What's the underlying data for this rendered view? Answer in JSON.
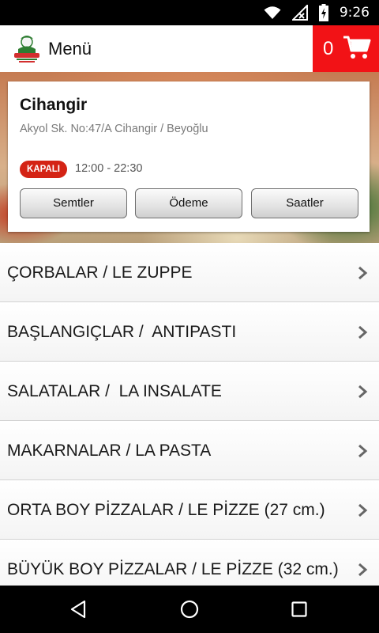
{
  "status_bar": {
    "time": "9:26",
    "icons": [
      "wifi-icon",
      "signal-off-icon",
      "battery-charging-icon"
    ]
  },
  "app_bar": {
    "title": "Menü",
    "cart_count": "0",
    "logo_icon": "restaurant-logo-icon",
    "cart_icon": "shopping-cart-icon"
  },
  "store": {
    "name": "Cihangir",
    "address": "Akyol Sk. No:47/A Cihangir / Beyoğlu",
    "status": "KAPALI",
    "hours": "12:00 - 22:30",
    "buttons": [
      "Semtler",
      "Ödeme",
      "Saatler"
    ]
  },
  "menu": {
    "items": [
      "ÇORBALAR / LE ZUPPE",
      "BAŞLANGIÇLAR /  ANTIPASTI",
      "SALATALAR /  LA INSALATE",
      "MAKARNALAR / LA PASTA",
      "ORTA BOY PİZZALAR / LE PİZZE (27 cm.)",
      "BÜYÜK BOY PİZZALAR / LE PİZZE (32 cm.)"
    ]
  },
  "nav": {
    "icons": [
      "back-icon",
      "home-icon",
      "recents-icon"
    ]
  },
  "colors": {
    "accent": "#f21216",
    "badge": "#d42415"
  }
}
